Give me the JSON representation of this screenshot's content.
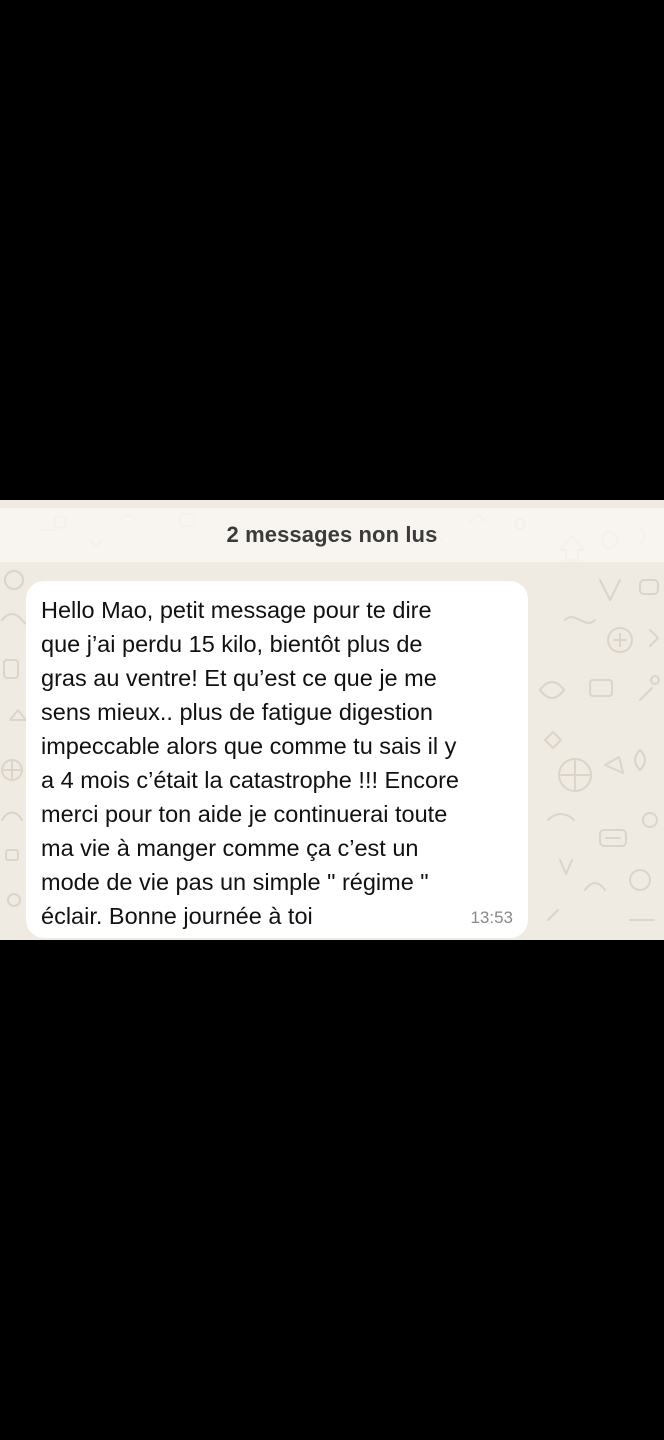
{
  "chat": {
    "unread_banner": "2 messages non lus",
    "messages": [
      {
        "text": "Hello Mao, petit message pour te dire\nque j’ai perdu 15 kilo, bientôt plus de\ngras au ventre! Et qu’est ce que je me\nsens mieux.. plus de fatigue digestion\nimpeccable alors que comme tu sais il y\na 4 mois c’était la catastrophe !!! Encore\nmerci pour ton aide je continuerai toute\nma vie à manger comme ça c’est un\nmode de vie pas un simple \" régime \"\néclair. Bonne journée à toi",
        "time": "13:53"
      }
    ]
  },
  "colors": {
    "chat_background": "#efeae2",
    "bubble_incoming": "#ffffff",
    "outer_background": "#000000"
  }
}
